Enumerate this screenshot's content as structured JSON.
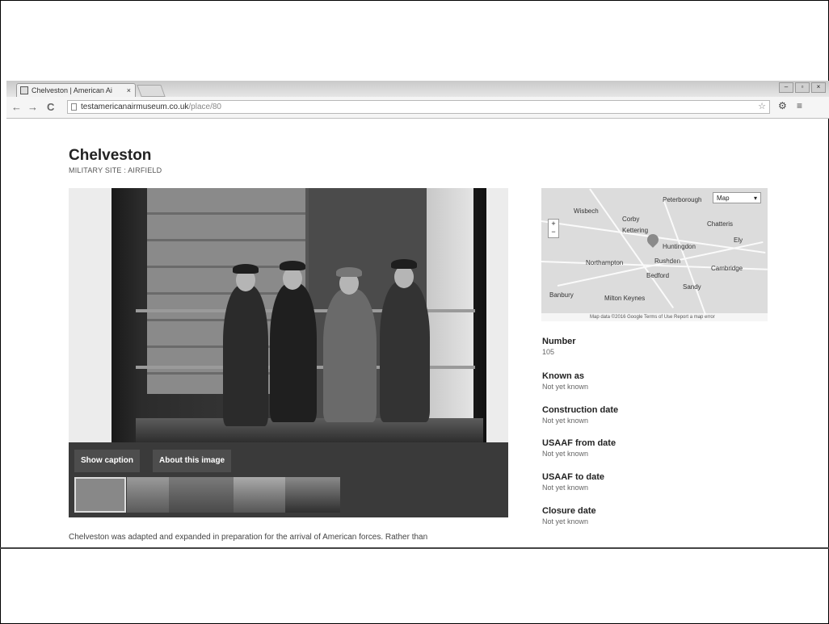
{
  "browser": {
    "tab_title": "Chelveston | American Ai",
    "tab_close": "×",
    "url_host": "testamericanairmuseum.co.uk",
    "url_path": "/place/80",
    "back": "←",
    "forward": "→",
    "reload": "C",
    "star": "☆",
    "window_controls": [
      "–",
      "▫",
      "×"
    ]
  },
  "page": {
    "title": "Chelveston",
    "subtitle": "MILITARY SITE : AIRFIELD"
  },
  "gallery": {
    "show_caption": "Show caption",
    "about_image": "About this image"
  },
  "map": {
    "type_select": "Map",
    "zoom_in": "+",
    "zoom_out": "−",
    "labels": [
      "Peterborough",
      "Wisbech",
      "Corby",
      "Kettering",
      "Huntingdon",
      "Chatteris",
      "Northampton",
      "Rushden",
      "Cambridge",
      "Bedford",
      "Banbury",
      "Milton Keynes",
      "Sandy",
      "Ely"
    ],
    "attribution": "Map data ©2016 Google  Terms of Use  Report a map error"
  },
  "facts": [
    {
      "label": "Number",
      "value": "105"
    },
    {
      "label": "Known as",
      "value": "Not yet known"
    },
    {
      "label": "Construction date",
      "value": "Not yet known"
    },
    {
      "label": "USAAF from date",
      "value": "Not yet known"
    },
    {
      "label": "USAAF to date",
      "value": "Not yet known"
    },
    {
      "label": "Closure date",
      "value": "Not yet known"
    }
  ],
  "body_text": "Chelveston was adapted and expanded in preparation for the arrival of American forces. Rather than"
}
